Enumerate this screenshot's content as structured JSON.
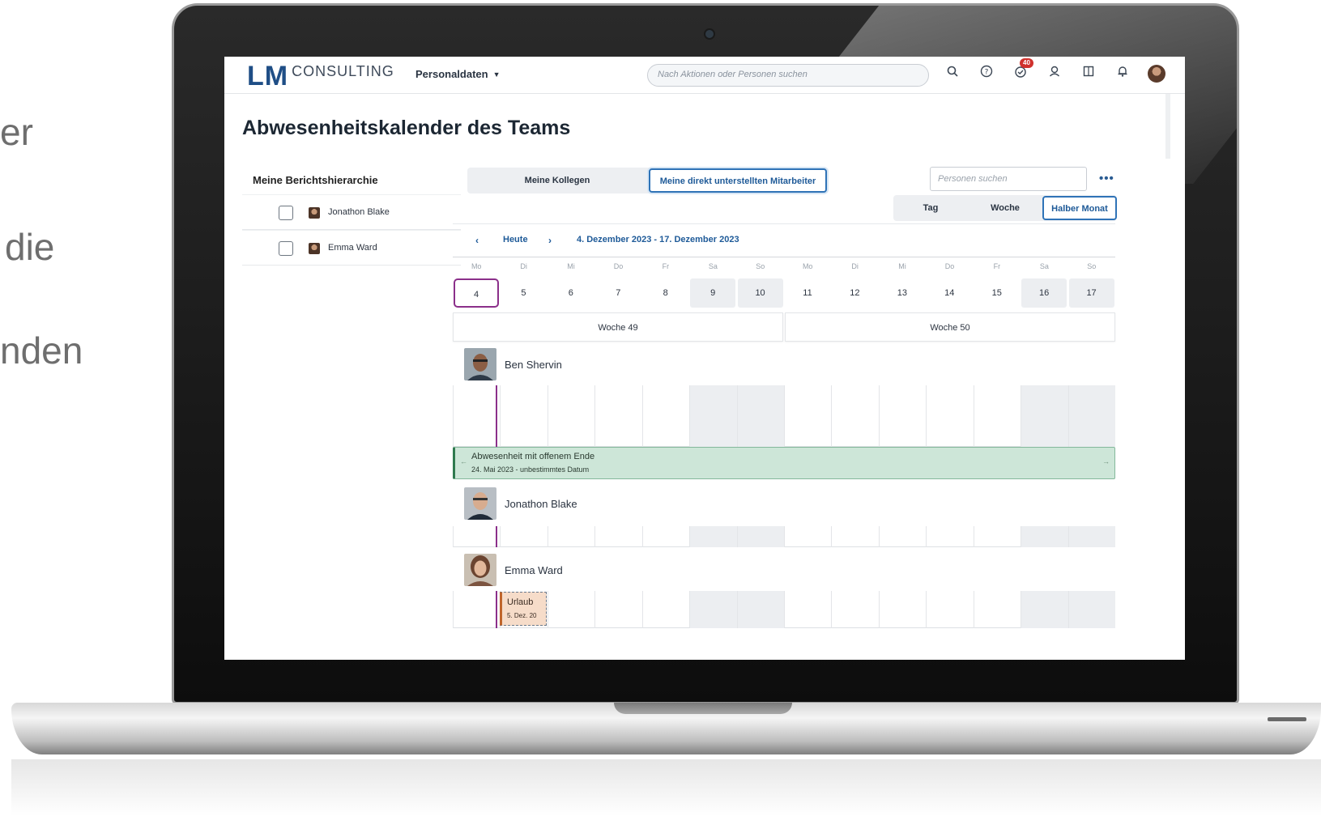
{
  "side_text": [
    "er",
    "die",
    "nden"
  ],
  "header": {
    "logo_lm": "LM",
    "logo_consulting": "CONSULTING",
    "menu_label": "Personaldaten",
    "search_placeholder": "Nach Aktionen oder Personen suchen",
    "notification_count": "40",
    "icons": [
      "search-icon",
      "help-icon",
      "tasks-icon",
      "people-icon",
      "book-icon",
      "bell-icon",
      "avatar"
    ]
  },
  "page_title": "Abwesenheitskalender des Teams",
  "toolbar": {
    "hierarchy_label": "Meine Berichtshierarchie",
    "tab_colleagues": "Meine Kollegen",
    "tab_direct_reports": "Meine direkt unterstellten Mitarbeiter",
    "people_search_placeholder": "Personen suchen",
    "more_label": "•••"
  },
  "view_switch": {
    "day": "Tag",
    "week": "Woche",
    "half_month": "Halber Monat"
  },
  "hierarchy_list": [
    {
      "name": "Jonathon Blake"
    },
    {
      "name": "Emma Ward"
    }
  ],
  "calendar": {
    "prev": "‹",
    "today_label": "Heute",
    "next": "›",
    "range_label": "4. Dezember 2023 - 17. Dezember 2023",
    "weekdays": [
      "Mo",
      "Di",
      "Mi",
      "Do",
      "Fr",
      "Sa",
      "So",
      "Mo",
      "Di",
      "Mi",
      "Do",
      "Fr",
      "Sa",
      "So"
    ],
    "dates": [
      "4",
      "5",
      "6",
      "7",
      "8",
      "9",
      "10",
      "11",
      "12",
      "13",
      "14",
      "15",
      "16",
      "17"
    ],
    "weekend_indexes": [
      5,
      6,
      12,
      13
    ],
    "selected_index": 0,
    "weeks": [
      "Woche 49",
      "Woche 50"
    ]
  },
  "people": [
    {
      "name": "Ben Shervin"
    },
    {
      "name": "Jonathon Blake"
    },
    {
      "name": "Emma Ward"
    }
  ],
  "absence_open": {
    "title": "Abwesenheit mit offenem Ende",
    "dates": "24. Mai 2023 - unbestimmtes Datum",
    "arrow_left": "←",
    "arrow_right": "→"
  },
  "absence_vacation": {
    "title": "Urlaub",
    "dates": "5. Dez. 20"
  },
  "colors": {
    "brand": "#1f4e86",
    "accent": "#2f73b7",
    "today": "#8b2f8a",
    "open_absence": "#cde6d8",
    "vacation": "#f6dcc9",
    "badge": "#d0312d"
  }
}
